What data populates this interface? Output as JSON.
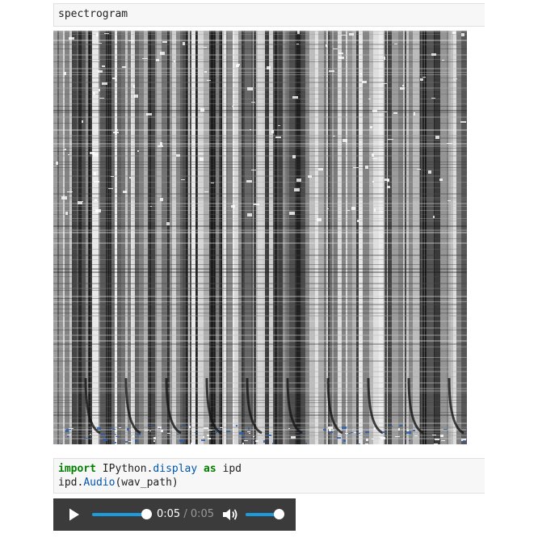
{
  "cell1": {
    "code": "spectrogram"
  },
  "image": {
    "description_icon": "spectrogram-image"
  },
  "cell2": {
    "line1": {
      "kw_import": "import",
      "module": " IPython.",
      "attr": "display",
      "sp": " ",
      "kw_as": "as",
      "alias": " ipd"
    },
    "line2": {
      "obj": "ipd.",
      "fn": "Audio",
      "args": "(wav_path)"
    }
  },
  "audio": {
    "current_time": "0:05",
    "separator": " / ",
    "duration": "0:05",
    "progress": 1.0,
    "volume": 1.0,
    "accent_color": "#1a9cde"
  }
}
